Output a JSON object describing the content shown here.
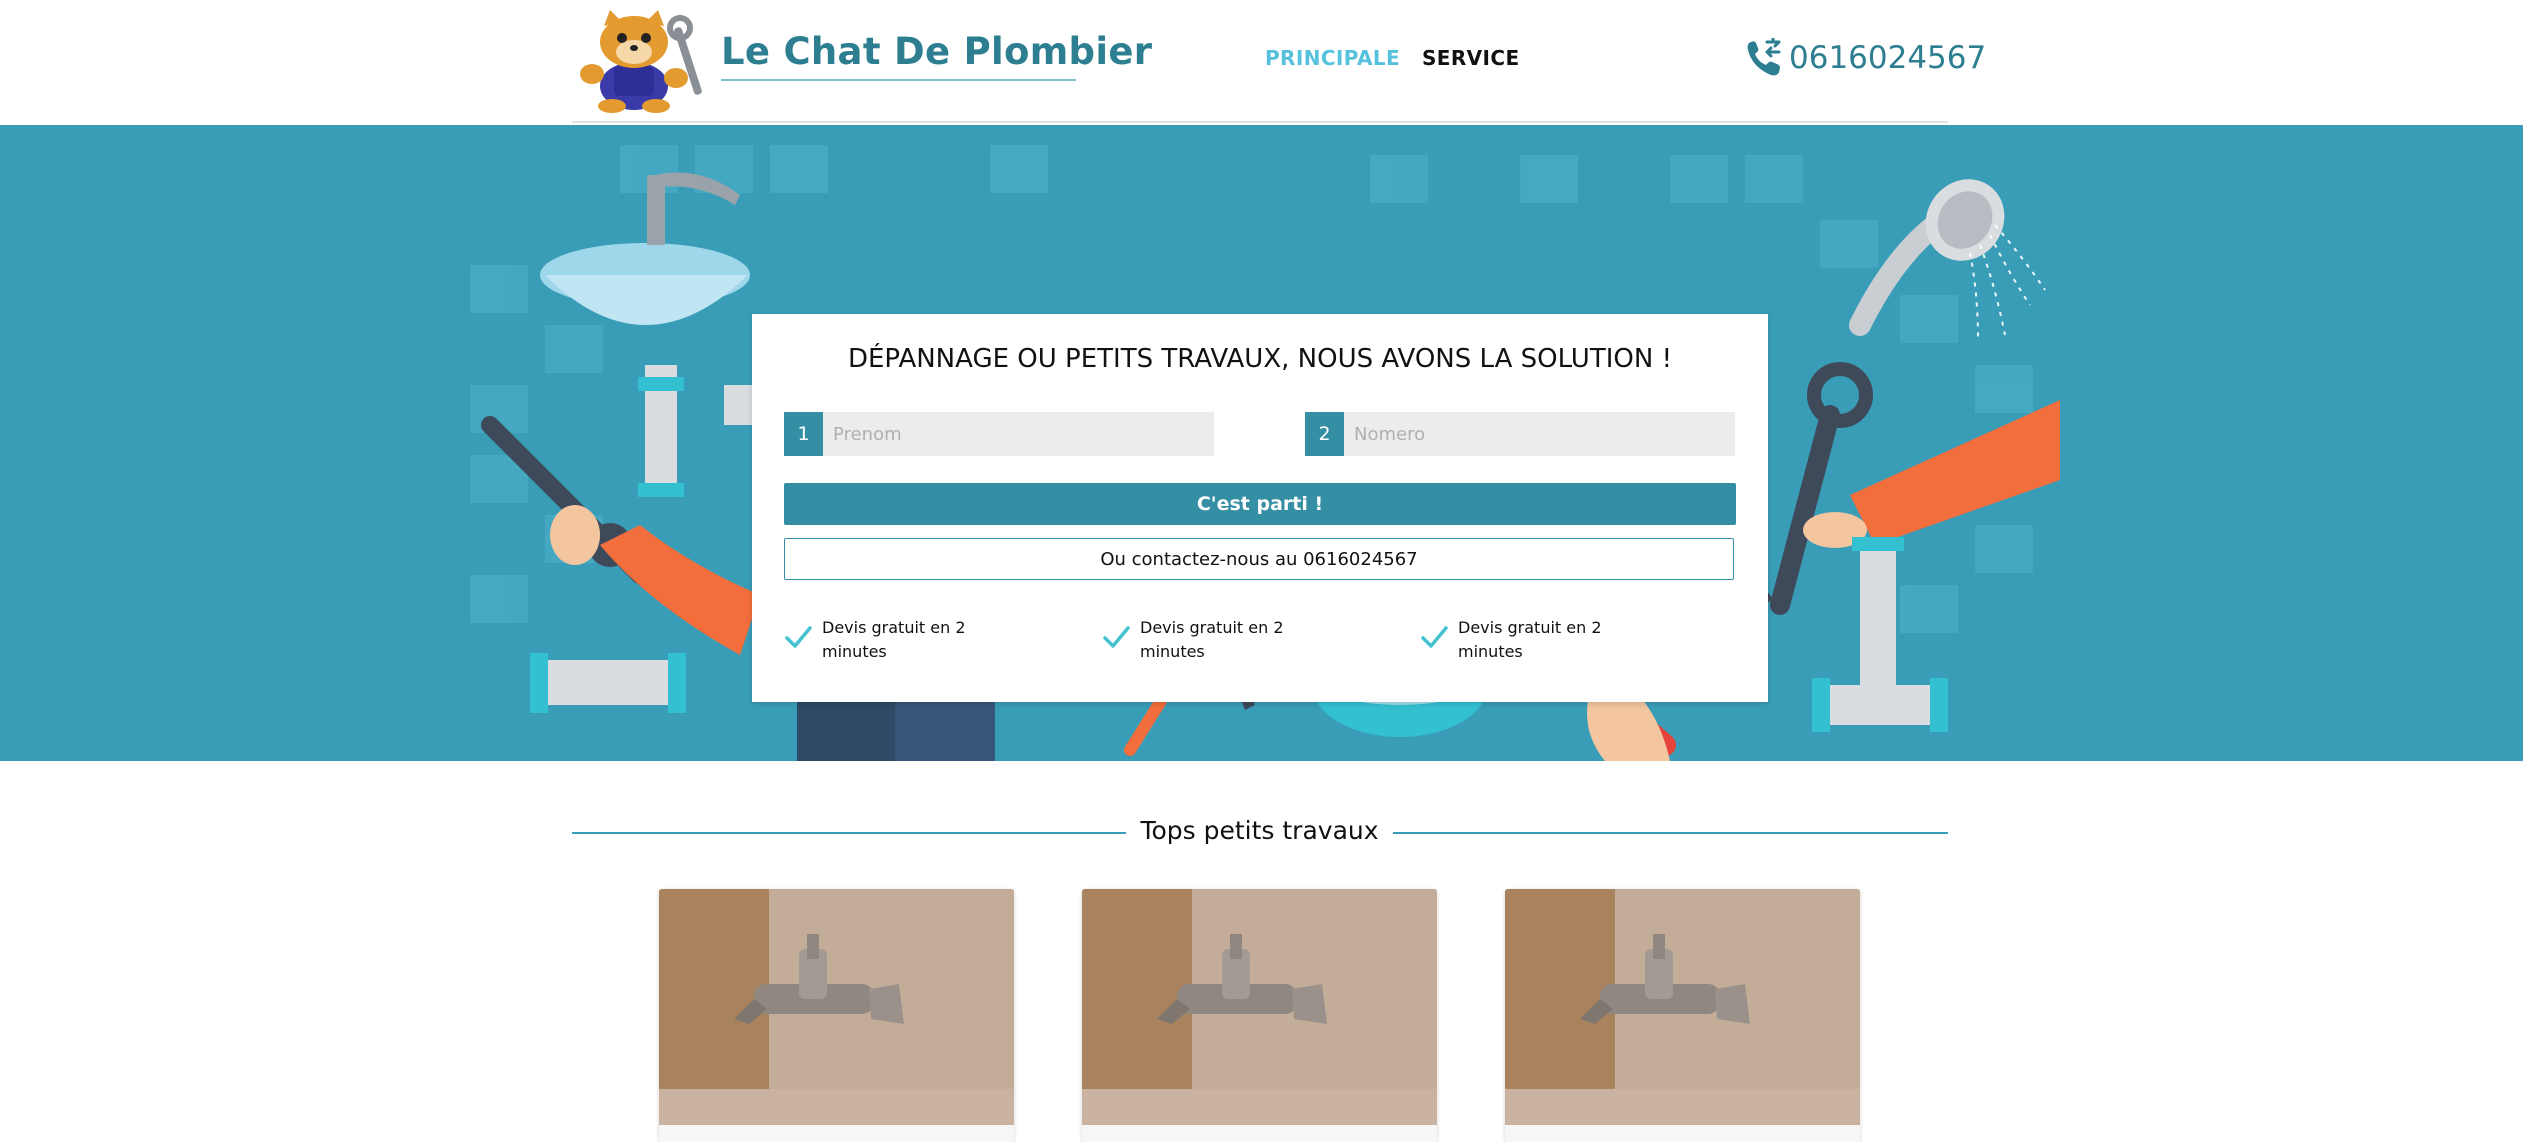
{
  "header": {
    "brand": "Le Chat De Plombier",
    "nav": [
      {
        "label": "PRINCIPALE",
        "active": true
      },
      {
        "label": "SERVICE",
        "active": false
      }
    ],
    "phone": "0616024567"
  },
  "hero": {
    "title": "DÉPANNAGE OU PETITS TRAVAUX, NOUS AVONS LA SOLUTION !",
    "fields": [
      {
        "number": "1",
        "placeholder": "Prenom",
        "value": ""
      },
      {
        "number": "2",
        "placeholder": "Nomero",
        "value": ""
      }
    ],
    "submit_label": "C'est parti !",
    "contact_label": "Ou contactez-nous au 0616024567",
    "features": [
      "Devis gratuit en 2 minutes",
      "Devis gratuit en 2 minutes",
      "Devis gratuit en 2 minutes"
    ]
  },
  "section": {
    "title": "Tops petits travaux"
  },
  "colors": {
    "accent": "#358fa4",
    "hero_bg": "#3a9db8",
    "brand": "#2d7e91",
    "nav_active": "#55c1dd",
    "check": "#45c2d0"
  },
  "icons": {
    "logo": "cat-plumber-mascot-logo",
    "phone": "phone-call-icon",
    "check": "check-icon",
    "hero": "plumbing-tools-illustration",
    "service_image": "wall-faucet-photo"
  }
}
